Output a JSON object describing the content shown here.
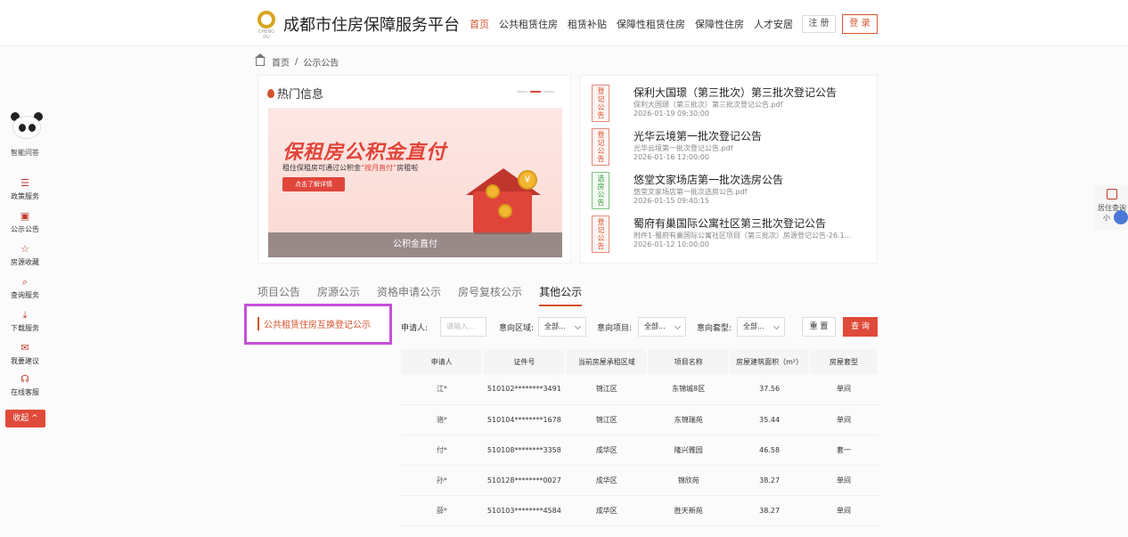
{
  "header": {
    "logo_text": "CHENG DU",
    "site_title": "成都市住房保障服务平台",
    "nav": [
      {
        "label": "首页",
        "active": true
      },
      {
        "label": "公共租赁住房",
        "active": false
      },
      {
        "label": "租赁补贴",
        "active": false
      },
      {
        "label": "保障性租赁住房",
        "active": false
      },
      {
        "label": "保障性住房",
        "active": false
      },
      {
        "label": "人才安居",
        "active": false
      }
    ],
    "register_label": "注 册",
    "login_label": "登 录"
  },
  "breadcrumb": {
    "home": "首页",
    "separator": "/",
    "current": "公示公告"
  },
  "left_sidebar": {
    "assistant_label": "智能问答",
    "items": [
      {
        "icon": "policy-icon",
        "glyph": "☰",
        "label": "政策服务"
      },
      {
        "icon": "notice-icon",
        "glyph": "▣",
        "label": "公示公告"
      },
      {
        "icon": "star-icon",
        "glyph": "☆",
        "label": "房源收藏"
      },
      {
        "icon": "search-icon",
        "glyph": "⌕",
        "label": "查询服务"
      },
      {
        "icon": "download-icon",
        "glyph": "⤓",
        "label": "下载服务"
      },
      {
        "icon": "mail-icon",
        "glyph": "✉",
        "label": "我要建议"
      },
      {
        "icon": "headset-icon",
        "glyph": "☊",
        "label": "在线客服"
      }
    ],
    "collapse_label": "收起 ^"
  },
  "right_float": {
    "label": "居住查询",
    "label2": "小"
  },
  "hot": {
    "title": "热门信息",
    "banner_headline": "保租房公积金直付",
    "banner_sub_prefix": "租住保租房可通过公积金",
    "banner_sub_highlight": "“按月直付”",
    "banner_sub_suffix": "房租啦",
    "banner_button": "点击了解详情",
    "banner_caption": "公积金直付",
    "coin_symbol": "¥"
  },
  "notices": [
    {
      "tag": "登记公告",
      "tag_color": "red",
      "title": "保利大国璟（第三批次）第三批次登记公告",
      "file": "保利大国璟（第三批次）第三批次登记公告.pdf",
      "time": "2026-01-19 09:30:00"
    },
    {
      "tag": "登记公告",
      "tag_color": "red",
      "title": "光华云境第一批次登记公告",
      "file": "光华云境第一批次登记公告.pdf",
      "time": "2026-01-16 12:00:00"
    },
    {
      "tag": "选房公告",
      "tag_color": "green",
      "title": "悠堂文家场店第一批次选房公告",
      "file": "悠堂文家场店第一批次选房公告.pdf",
      "time": "2026-01-15 09:40:15"
    },
    {
      "tag": "登记公告",
      "tag_color": "red",
      "title": "蜀府有巢国际公寓社区第三批次登记公告",
      "file": "附件1-蜀府有巢国际公寓社区项目（第三批次）房源登记公告-26.1...",
      "time": "2026-01-12 10:00:00"
    }
  ],
  "tabs": [
    {
      "label": "项目公告",
      "active": false
    },
    {
      "label": "房源公示",
      "active": false
    },
    {
      "label": "资格申请公示",
      "active": false
    },
    {
      "label": "房号复核公示",
      "active": false
    },
    {
      "label": "其他公示",
      "active": true
    }
  ],
  "category": {
    "label": "公共租赁住房互换登记公示"
  },
  "filters": {
    "applicant_label": "申请人:",
    "applicant_placeholder": "请输入...",
    "district_label": "意向区域:",
    "district_value": "全部...",
    "project_label": "意向项目:",
    "project_value": "全部...",
    "type_label": "意向套型:",
    "type_value": "全部...",
    "reset_label": "重 置",
    "query_label": "查 询"
  },
  "table": {
    "headers": [
      "申请人",
      "证件号",
      "当前房屋承租区域",
      "项目名称",
      "房屋建筑面积（m²）",
      "房屋套型"
    ],
    "rows": [
      [
        "江*",
        "510102********3491",
        "锦江区",
        "东锦城8区",
        "37.56",
        "单间"
      ],
      [
        "骆*",
        "510104********1678",
        "锦江区",
        "东锦瑞苑",
        "35.44",
        "单间"
      ],
      [
        "付*",
        "510108********3358",
        "成华区",
        "隆兴雅园",
        "46.58",
        "套一"
      ],
      [
        "孙*",
        "510128********0027",
        "成华区",
        "锦欣苑",
        "38.27",
        "单间"
      ],
      [
        "薛*",
        "510103********4584",
        "成华区",
        "胜天新苑",
        "38.27",
        "单间"
      ]
    ]
  },
  "colors": {
    "accent": "#d4532b",
    "primary_button": "#e04a3a",
    "highlight_frame": "#c64fd9",
    "tag_green": "#3c9a3c"
  }
}
